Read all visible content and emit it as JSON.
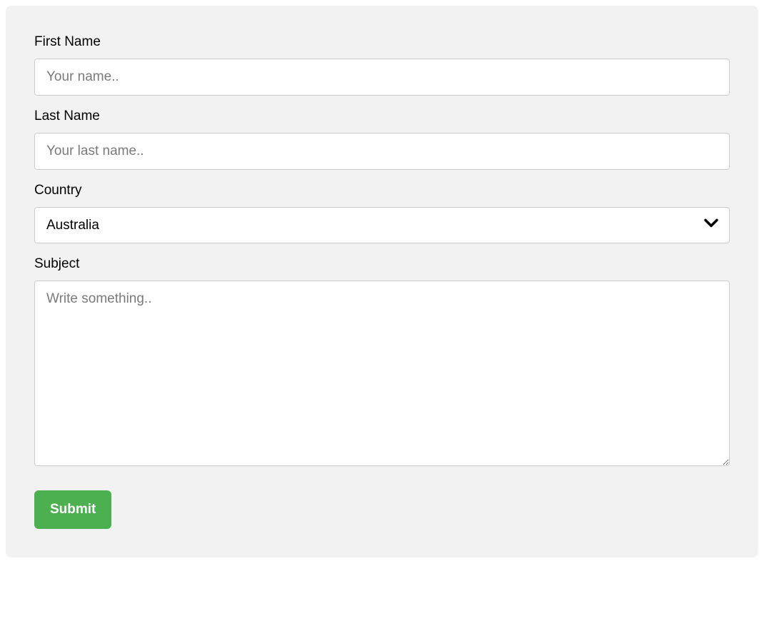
{
  "form": {
    "first_name": {
      "label": "First Name",
      "placeholder": "Your name..",
      "value": ""
    },
    "last_name": {
      "label": "Last Name",
      "placeholder": "Your last name..",
      "value": ""
    },
    "country": {
      "label": "Country",
      "selected": "Australia"
    },
    "subject": {
      "label": "Subject",
      "placeholder": "Write something..",
      "value": ""
    },
    "submit_label": "Submit"
  },
  "colors": {
    "accent": "#4CAF50",
    "panel": "#f2f2f2",
    "border": "#cccccc"
  }
}
